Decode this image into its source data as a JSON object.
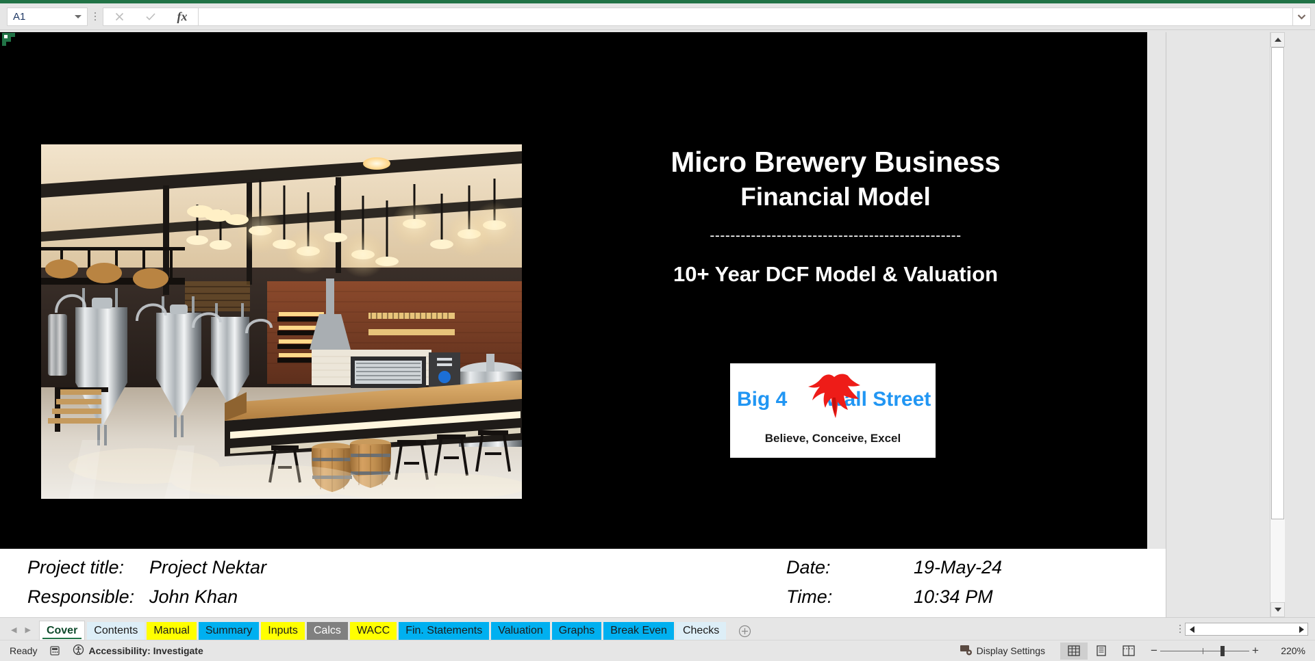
{
  "formula_bar": {
    "name_box_value": "A1",
    "cancel_icon": "close-icon",
    "confirm_icon": "check-icon",
    "function_icon": "fx-icon",
    "formula_value": "",
    "expand_icon": "chevron-down-icon"
  },
  "slide": {
    "title_line1": "Micro Brewery Business",
    "title_line2": "Financial Model",
    "divider": "-------------------------------------------------",
    "subtitle": "10+ Year DCF Model & Valuation",
    "photo_alt": "brewery-interior-photo",
    "logo": {
      "word_left": "Big 4",
      "word_right": "Wall Street",
      "tagline": "Believe, Conceive, Excel",
      "eagle_icon": "eagle-icon",
      "brand_blue": "#2196f3",
      "eagle_red": "#ee1c18"
    },
    "background_color": "#000000"
  },
  "info": {
    "project_title_label": "Project title:",
    "project_title_value": "Project Nektar",
    "responsible_label": "Responsible:",
    "responsible_value": "John Khan",
    "date_label": "Date:",
    "date_value": "19-May-24",
    "time_label": "Time:",
    "time_value": "10:34 PM"
  },
  "tabs": {
    "prev_icon": "chevron-left-icon",
    "next_icon": "chevron-right-icon",
    "add_icon": "plus-circle-icon",
    "items": [
      {
        "label": "Cover",
        "bg": "#ffffff",
        "fg": "#0e4a2b",
        "active": true
      },
      {
        "label": "Contents",
        "bg": "#ddeef7",
        "fg": "#1b1b1b",
        "active": false
      },
      {
        "label": "Manual",
        "bg": "#ffff00",
        "fg": "#1b1b1b",
        "active": false
      },
      {
        "label": "Summary",
        "bg": "#00b0f0",
        "fg": "#1b1b1b",
        "active": false
      },
      {
        "label": "Inputs",
        "bg": "#ffff00",
        "fg": "#1b1b1b",
        "active": false
      },
      {
        "label": "Calcs",
        "bg": "#808080",
        "fg": "#ffffff",
        "active": false
      },
      {
        "label": "WACC",
        "bg": "#ffff00",
        "fg": "#1b1b1b",
        "active": false
      },
      {
        "label": "Fin. Statements",
        "bg": "#00b0f0",
        "fg": "#1b1b1b",
        "active": false
      },
      {
        "label": "Valuation",
        "bg": "#00b0f0",
        "fg": "#1b1b1b",
        "active": false
      },
      {
        "label": "Graphs",
        "bg": "#00b0f0",
        "fg": "#1b1b1b",
        "active": false
      },
      {
        "label": "Break Even",
        "bg": "#00b0f0",
        "fg": "#1b1b1b",
        "active": false
      },
      {
        "label": "Checks",
        "bg": "#ddeef7",
        "fg": "#1b1b1b",
        "active": false
      }
    ]
  },
  "statusbar": {
    "mode": "Ready",
    "macro_icon": "record-macro-icon",
    "accessibility_icon": "accessibility-icon",
    "accessibility_label": "Accessibility: Investigate",
    "display_settings_icon": "display-settings-icon",
    "display_settings_label": "Display Settings",
    "view_normal_icon": "normal-view-icon",
    "view_layout_icon": "page-layout-icon",
    "view_pagebreak_icon": "page-break-view-icon",
    "zoom_out": "−",
    "zoom_in": "+",
    "zoom_level": "220%"
  }
}
